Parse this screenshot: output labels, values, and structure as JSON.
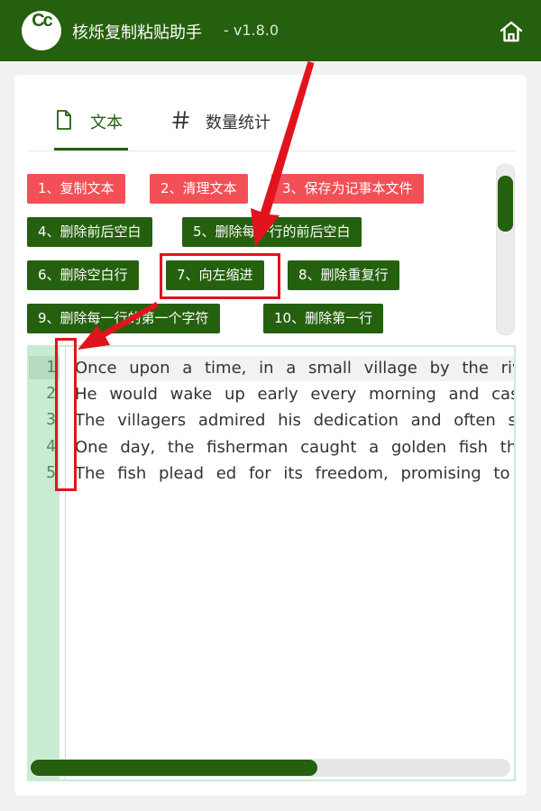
{
  "app": {
    "logo_text": "Cc",
    "title": "核烁复制粘贴助手",
    "version": "- v1.8.0"
  },
  "tabs": [
    {
      "label": "文本",
      "icon": "document-icon",
      "active": true
    },
    {
      "label": "数量统计",
      "icon": "hash-icon",
      "active": false
    }
  ],
  "buttons": [
    {
      "label": "1、复制文本",
      "color": "#f24f56"
    },
    {
      "label": "2、清理文本",
      "color": "#f24f56"
    },
    {
      "label": "3、保存为记事本文件",
      "color": "#f24f56"
    },
    {
      "label": "4、删除前后空白",
      "color": "#25600f"
    },
    {
      "label": "5、删除每一行的前后空白",
      "color": "#25600f"
    },
    {
      "label": "6、删除空白行",
      "color": "#25600f"
    },
    {
      "label": "7、向左缩进",
      "color": "#25600f"
    },
    {
      "label": "8、删除重复行",
      "color": "#25600f"
    },
    {
      "label": "9、删除每一行的第一个字符",
      "color": "#25600f"
    },
    {
      "label": "10、删除第一行",
      "color": "#25600f"
    }
  ],
  "editor": {
    "line_numbers": [
      "1",
      "2",
      "3",
      "4",
      "5"
    ],
    "lines": [
      "Once upon a time, in a small village by the river",
      "He would wake up early every morning and cast his net",
      "The villagers admired his dedication and often stopped",
      "One day, the fisherman caught a golden fish that",
      "The fish plead ed for its freedom, promising to"
    ]
  },
  "colors": {
    "brand_green": "#25600f",
    "danger_red": "#f24f56",
    "gutter_green": "#c8ecd2",
    "annotation_red": "#e1141e"
  }
}
